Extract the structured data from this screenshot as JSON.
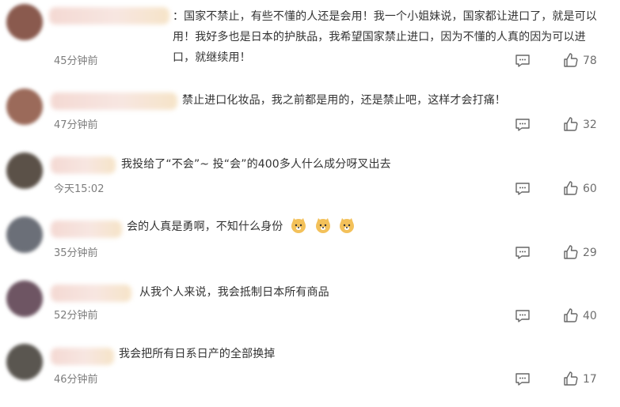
{
  "comments": [
    {
      "text": "：国家不禁止，有些不懂的人还是会用！我一个小姐妹说，国家都让进口了，就是可以用！我好多也是日本的护肤品，我希望国家禁止进口，因为不懂的人真的因为可以进口，就继续用！",
      "time": "45分钟前",
      "likes": "78",
      "avatar_color": "#8a5a4e"
    },
    {
      "text": "禁止进口化妆品，我之前都是用的，还是禁止吧，这样才会打痛！",
      "time": "47分钟前",
      "likes": "32",
      "avatar_color": "#9b6a5a"
    },
    {
      "text": "我投给了“不会”~ 投“会”的400多人什么成分呀叉出去",
      "time": "今天15:02",
      "likes": "60",
      "avatar_color": "#5b5148"
    },
    {
      "text": "会的人真是勇啊，不知什么身份",
      "time": "35分钟前",
      "likes": "29",
      "avatar_color": "#6b6f78"
    },
    {
      "text": "从我个人来说，我会抵制日本所有商品",
      "time": "52分钟前",
      "likes": "40",
      "avatar_color": "#6e5563"
    },
    {
      "text": "我会把所有日系日产的全部换掉",
      "time": "46分钟前",
      "likes": "17",
      "avatar_color": "#5a5650"
    }
  ],
  "icons": {
    "reply": "comment-icon",
    "like": "thumbs-up-icon",
    "emoji": "doge-emoji-icon"
  }
}
